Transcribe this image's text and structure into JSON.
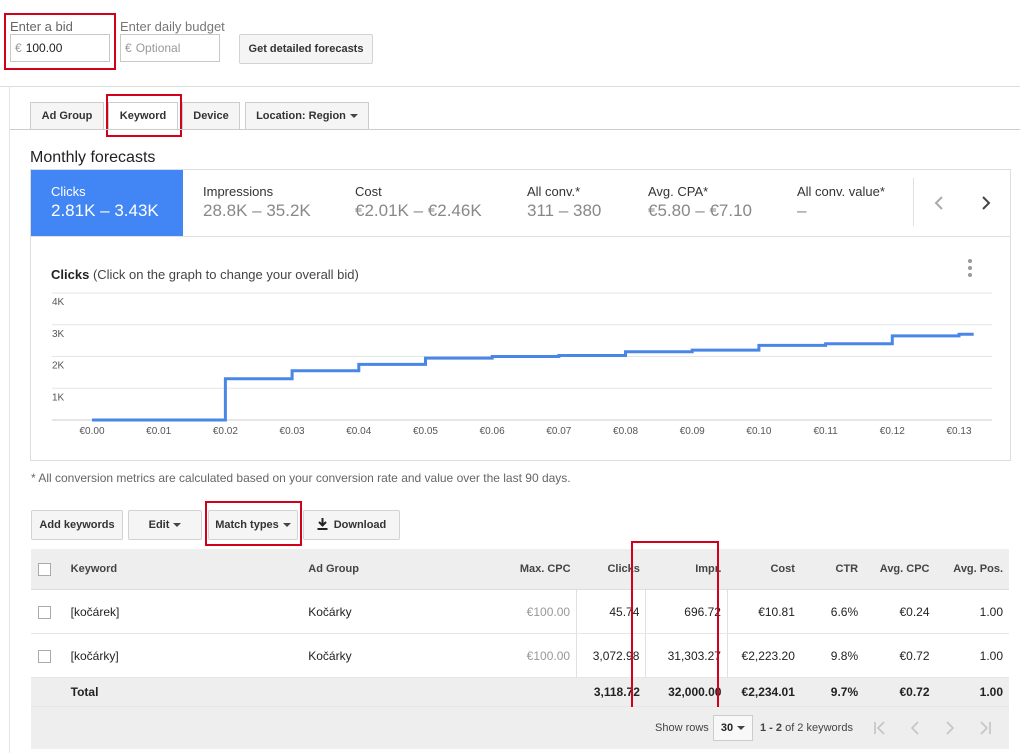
{
  "bid": {
    "label": "Enter a bid",
    "currency": "€",
    "value": "100.00"
  },
  "budget": {
    "label": "Enter daily budget",
    "currency": "€",
    "placeholder": "Optional"
  },
  "forecast_button": "Get detailed forecasts",
  "tabs": [
    {
      "label": "Ad Group"
    },
    {
      "label": "Keyword"
    },
    {
      "label": "Device"
    },
    {
      "label": "Location: Region"
    }
  ],
  "section_title": "Monthly forecasts",
  "metrics": [
    {
      "name": "Clicks",
      "value": "2.81K – 3.43K"
    },
    {
      "name": "Impressions",
      "value": "28.8K – 35.2K"
    },
    {
      "name": "Cost",
      "value": "€2.01K – €2.46K"
    },
    {
      "name": "All conv.*",
      "value": "311 – 380"
    },
    {
      "name": "Avg. CPA*",
      "value": "€5.80 – €7.10"
    },
    {
      "name": "All conv. value*",
      "value": "–"
    }
  ],
  "chart_title_bold": "Clicks",
  "chart_title_rest": "(Click on the graph to change your overall bid)",
  "chart_data": {
    "type": "line",
    "x": [
      "€0.00",
      "€0.01",
      "€0.02",
      "€0.03",
      "€0.04",
      "€0.05",
      "€0.06",
      "€0.07",
      "€0.08",
      "€0.09",
      "€0.10",
      "€0.11",
      "€0.12",
      "€0.13"
    ],
    "y_tick_labels": [
      "4K",
      "3K",
      "2K",
      "1K"
    ],
    "ylim": [
      0,
      4000
    ],
    "steps": [
      [
        0.0,
        0
      ],
      [
        0.02,
        0
      ],
      [
        0.02,
        1300
      ],
      [
        0.03,
        1300
      ],
      [
        0.03,
        1550
      ],
      [
        0.04,
        1550
      ],
      [
        0.04,
        1750
      ],
      [
        0.05,
        1750
      ],
      [
        0.05,
        1950
      ],
      [
        0.06,
        1950
      ],
      [
        0.06,
        2000
      ],
      [
        0.07,
        2000
      ],
      [
        0.07,
        2030
      ],
      [
        0.08,
        2030
      ],
      [
        0.08,
        2150
      ],
      [
        0.09,
        2150
      ],
      [
        0.09,
        2200
      ],
      [
        0.1,
        2200
      ],
      [
        0.1,
        2350
      ],
      [
        0.11,
        2350
      ],
      [
        0.11,
        2400
      ],
      [
        0.12,
        2400
      ],
      [
        0.12,
        2650
      ],
      [
        0.13,
        2650
      ],
      [
        0.13,
        2700
      ],
      [
        0.1322,
        2700
      ]
    ],
    "color": "#4a86e8"
  },
  "footnote": "* All conversion metrics are calculated based on your conversion rate and value over the last 90 days.",
  "actions": {
    "add_keywords": "Add keywords",
    "edit": "Edit",
    "match_types": "Match types",
    "download": "Download"
  },
  "table": {
    "headers": [
      "Keyword",
      "Ad Group",
      "Max. CPC",
      "Clicks",
      "Impr.",
      "Cost",
      "CTR",
      "Avg. CPC",
      "Avg. Pos."
    ],
    "rows": [
      [
        "[kočárek]",
        "Kočárky",
        "€100.00",
        "45.74",
        "696.72",
        "€10.81",
        "6.6%",
        "€0.24",
        "1.00"
      ],
      [
        "[kočárky]",
        "Kočárky",
        "€100.00",
        "3,072.98",
        "31,303.27",
        "€2,223.20",
        "9.8%",
        "€0.72",
        "1.00"
      ]
    ],
    "total": [
      "Total",
      "",
      "",
      "3,118.72",
      "32,000.00",
      "€2,234.01",
      "9.7%",
      "€0.72",
      "1.00"
    ]
  },
  "pagination": {
    "show_rows_label": "Show rows",
    "rows_value": "30",
    "range_bold": "1 - 2",
    "range_rest": "of 2 keywords"
  }
}
